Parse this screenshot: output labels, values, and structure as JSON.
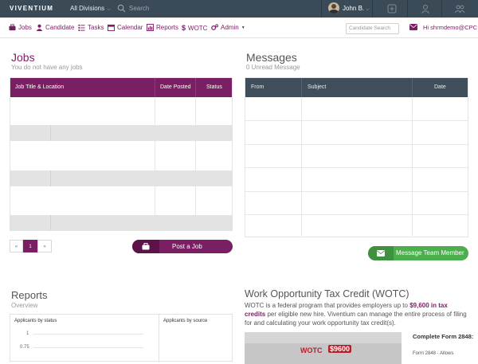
{
  "topbar": {
    "logo": "VIVENTIUM",
    "divisions": "All Divisions",
    "search_placeholder": "Search",
    "user_name": "John B."
  },
  "nav": {
    "items": [
      {
        "label": "Jobs",
        "icon": "briefcase-icon"
      },
      {
        "label": "Candidate",
        "icon": "user-icon"
      },
      {
        "label": "Tasks",
        "icon": "tasks-icon"
      },
      {
        "label": "Calendar",
        "icon": "calendar-icon"
      },
      {
        "label": "Reports",
        "icon": "chart-icon"
      },
      {
        "label": "WOTC",
        "icon": "dollar-icon"
      },
      {
        "label": "Admin",
        "icon": "gears-icon"
      }
    ],
    "candidate_search_placeholder": "Candidate Search",
    "greeting": "Hi shrmdemo@CPC"
  },
  "jobs": {
    "title": "Jobs",
    "subtitle": "You do not have any jobs",
    "columns": [
      "Job Title & Location",
      "Date Posted",
      "Status"
    ],
    "pager": [
      "«",
      "1",
      "»"
    ],
    "post_button": "Post a Job"
  },
  "messages": {
    "title": "Messages",
    "subtitle": "0 Unread Message",
    "columns": [
      "From",
      "Subject",
      "Date"
    ],
    "team_button": "Message Team Member"
  },
  "reports": {
    "title": "Reports",
    "subtitle": "Overview",
    "panel1": "Applicants by status",
    "panel2": "Applicants by source",
    "ticks": [
      "1",
      "0.75"
    ]
  },
  "wotc": {
    "title": "Work Opportunity Tax Credit (WOTC)",
    "text_before": "WOTC is a federal program that provides employers up to ",
    "text_bold": "$9,600 in tax credits",
    "text_after": " per eligible new hire. Viventium can manage the entire process of filing for and calculating your work opportunity tax credit(s).",
    "badge_label": "WOTC",
    "badge_amount": "$9600",
    "side_title": "Complete Form 2848:",
    "side_desc": "Form 2848 - Allows"
  },
  "colors": {
    "brand": "#7a1f63",
    "topbar": "#3a4a57",
    "message_header": "#3f4e5a",
    "green": "#4cae4c"
  }
}
